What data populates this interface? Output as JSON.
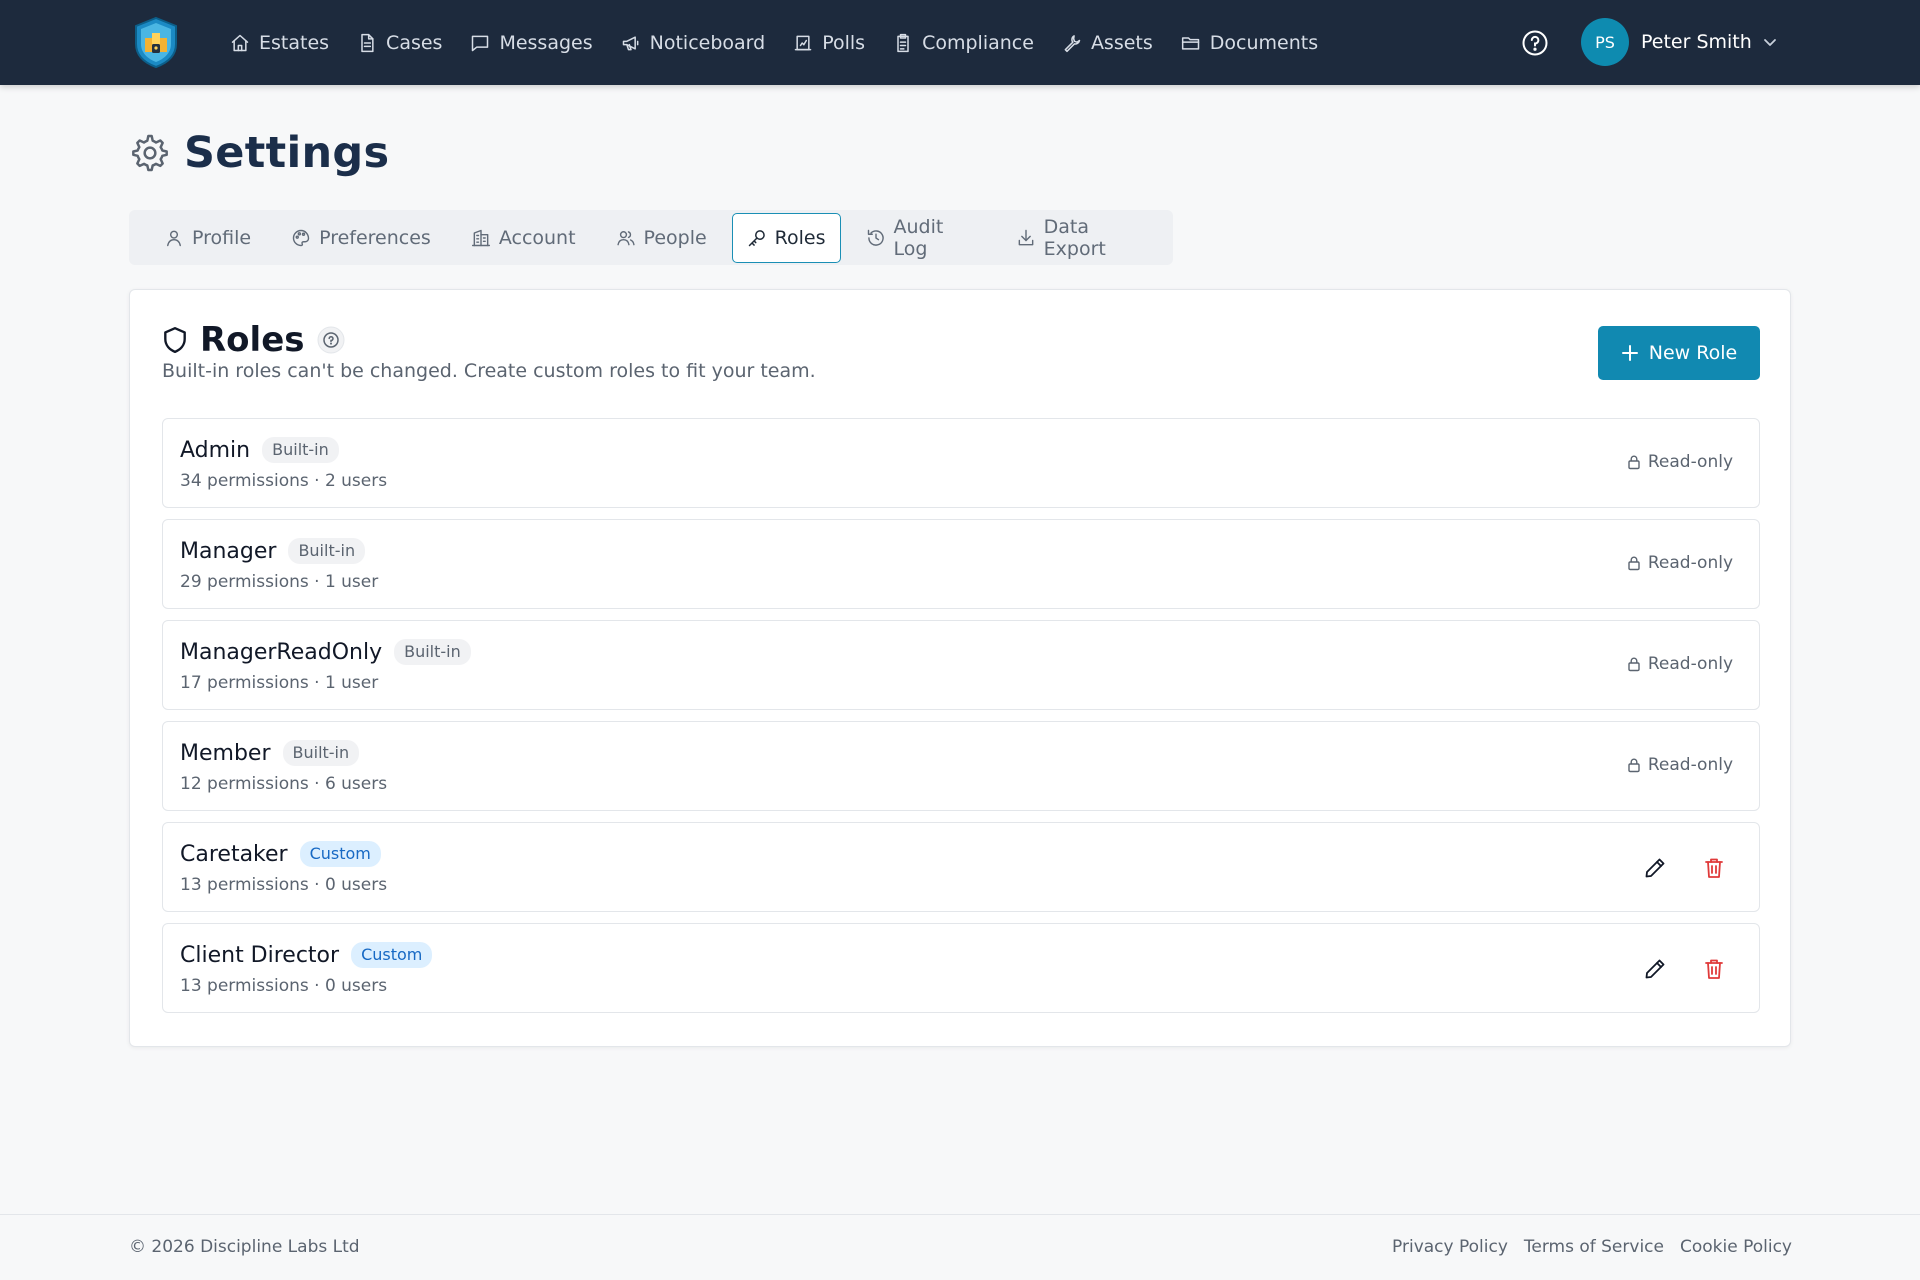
{
  "nav": {
    "items": [
      {
        "label": "Estates",
        "icon": "home-icon"
      },
      {
        "label": "Cases",
        "icon": "file-icon"
      },
      {
        "label": "Messages",
        "icon": "message-icon"
      },
      {
        "label": "Noticeboard",
        "icon": "megaphone-icon"
      },
      {
        "label": "Polls",
        "icon": "poll-icon"
      },
      {
        "label": "Compliance",
        "icon": "clipboard-icon"
      },
      {
        "label": "Assets",
        "icon": "wrench-icon"
      },
      {
        "label": "Documents",
        "icon": "folder-icon"
      }
    ],
    "user": {
      "initials": "PS",
      "name": "Peter Smith"
    }
  },
  "page": {
    "title": "Settings"
  },
  "tabs": [
    {
      "label": "Profile",
      "icon": "user-icon"
    },
    {
      "label": "Preferences",
      "icon": "palette-icon"
    },
    {
      "label": "Account",
      "icon": "building-icon"
    },
    {
      "label": "People",
      "icon": "people-icon"
    },
    {
      "label": "Roles",
      "icon": "key-icon",
      "active": true
    },
    {
      "label": "Audit Log",
      "icon": "history-icon"
    },
    {
      "label": "Data Export",
      "icon": "download-icon"
    }
  ],
  "roles_card": {
    "title": "Roles",
    "subtitle": "Built-in roles can't be changed. Create custom roles to fit your team.",
    "new_role_label": "New Role",
    "readonly_label": "Read-only",
    "roles": [
      {
        "name": "Admin",
        "badge": "Built-in",
        "meta": "34 permissions · 2 users"
      },
      {
        "name": "Manager",
        "badge": "Built-in",
        "meta": "29 permissions · 1 user"
      },
      {
        "name": "ManagerReadOnly",
        "badge": "Built-in",
        "meta": "17 permissions · 1 user"
      },
      {
        "name": "Member",
        "badge": "Built-in",
        "meta": "12 permissions · 6 users"
      },
      {
        "name": "Caretaker",
        "badge": "Custom",
        "meta": "13 permissions · 0 users"
      },
      {
        "name": "Client Director",
        "badge": "Custom",
        "meta": "13 permissions · 0 users"
      }
    ]
  },
  "footer": {
    "copyright": "© 2026 Discipline Labs Ltd",
    "links": [
      "Privacy Policy",
      "Terms of Service",
      "Cookie Policy"
    ]
  },
  "colors": {
    "nav_bg": "#1d2a3d",
    "accent": "#1189b1",
    "avatar": "#0e8bb0",
    "delete": "#e03a3a",
    "custom_badge_bg": "#dcefff",
    "custom_badge_text": "#1769c4"
  }
}
